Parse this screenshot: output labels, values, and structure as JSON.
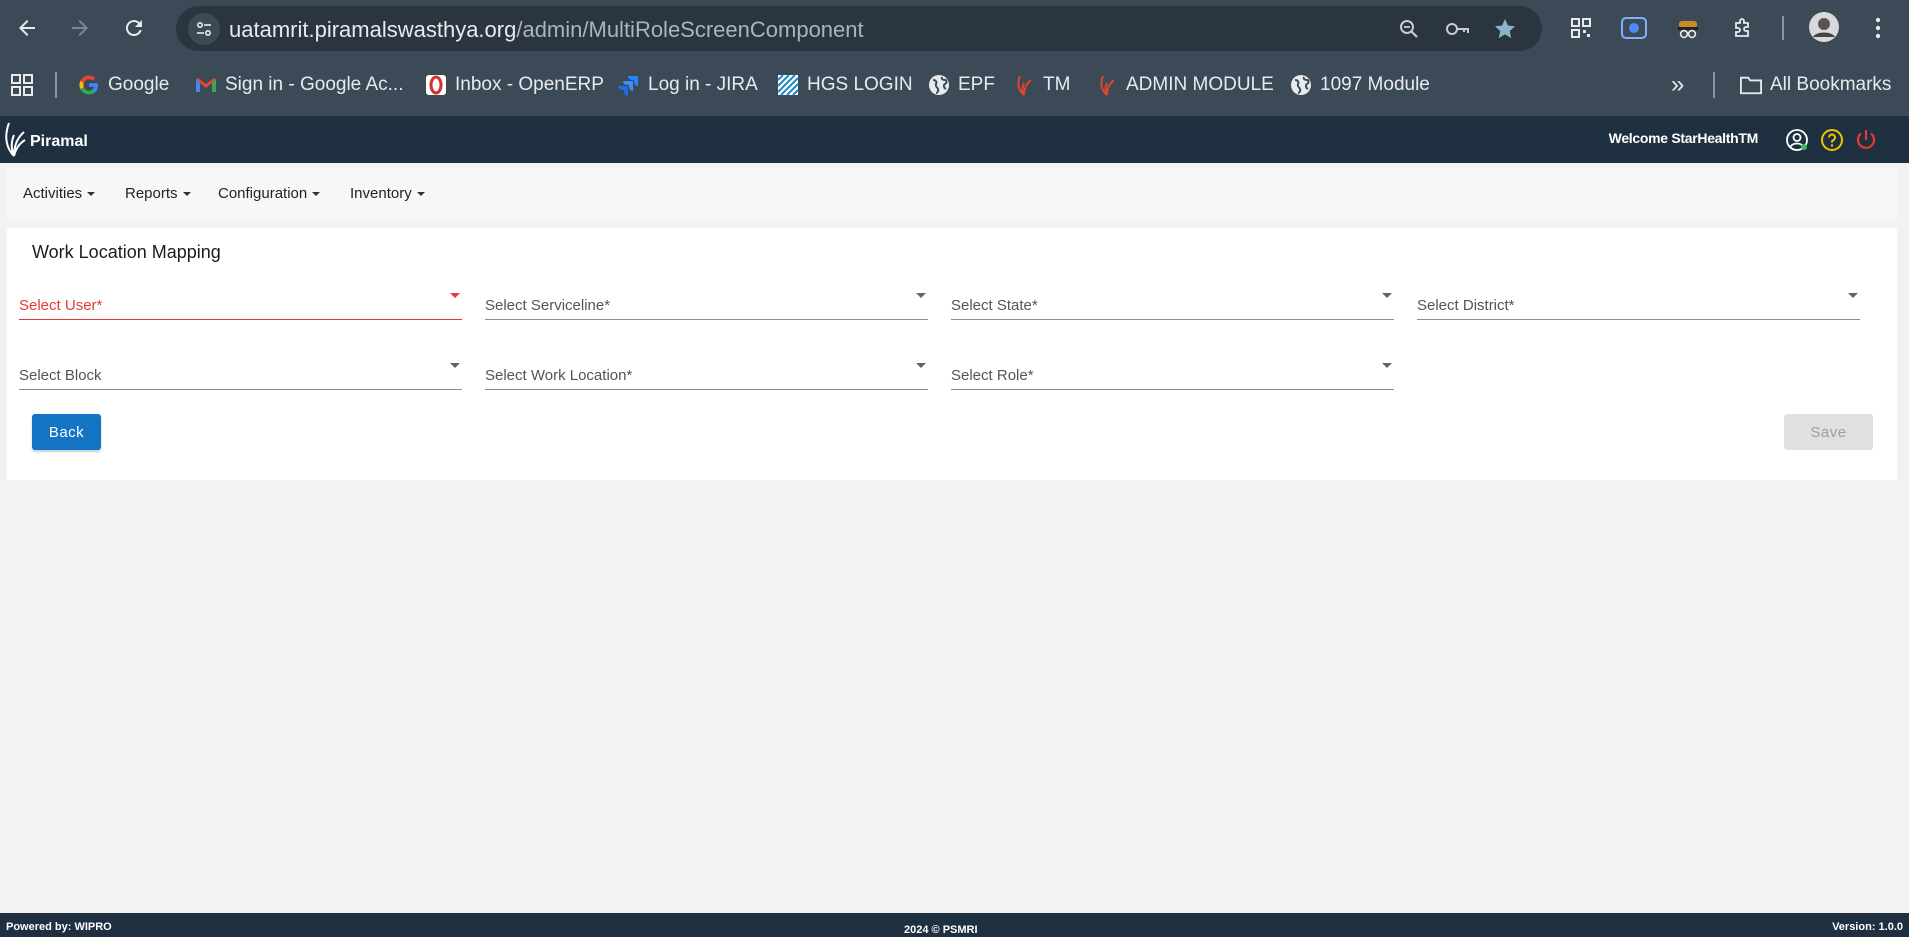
{
  "browser": {
    "url_host": "uatamrit.piramalswasthya.org",
    "url_path": "/admin/MultiRoleScreenComponent",
    "bookmarks": [
      {
        "label": "Google",
        "icon": "google-icon"
      },
      {
        "label": "Sign in - Google Ac...",
        "icon": "gmail-icon"
      },
      {
        "label": "Inbox - OpenERP",
        "icon": "openerp-icon"
      },
      {
        "label": "Log in - JIRA",
        "icon": "jira-icon"
      },
      {
        "label": "HGS LOGIN",
        "icon": "hgs-icon"
      },
      {
        "label": "EPF",
        "icon": "globe-icon"
      },
      {
        "label": "TM",
        "icon": "piramal-icon"
      },
      {
        "label": "ADMIN MODULE",
        "icon": "piramal-icon"
      },
      {
        "label": "1097 Module",
        "icon": "globe-icon"
      }
    ],
    "all_bookmarks_label": "All Bookmarks",
    "overflow_label": "»"
  },
  "app": {
    "logo_text": "Piramal",
    "welcome": "Welcome StarHealthTM"
  },
  "menu": [
    {
      "label": "Activities"
    },
    {
      "label": "Reports"
    },
    {
      "label": "Configuration"
    },
    {
      "label": "Inventory"
    }
  ],
  "form": {
    "title": "Work Location Mapping",
    "fields": {
      "user": "Select User*",
      "serviceline": "Select Serviceline*",
      "state": "Select State*",
      "district": "Select District*",
      "block": "Select Block",
      "work_location": "Select Work Location*",
      "role": "Select Role*"
    },
    "back_label": "Back",
    "save_label": "Save"
  },
  "footer": {
    "powered_by": "Powered by: WIPRO",
    "copyright": "2024 © PSMRI",
    "version": "Version: 1.0.0"
  },
  "colors": {
    "browser_bg": "#3c4a57",
    "app_header": "#1f3040",
    "primary_button": "#1474c4",
    "error": "#e53935"
  }
}
